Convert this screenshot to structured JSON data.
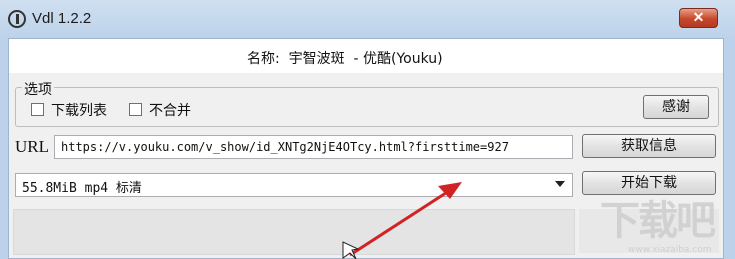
{
  "window": {
    "title": "Vdl 1.2.2",
    "close_label": "✕"
  },
  "info": {
    "name_text": "名称:  宇智波斑  - 优酷(Youku)"
  },
  "options": {
    "group_label": "选项",
    "download_list_label": "下载列表",
    "no_merge_label": "不合并",
    "thanks_label": "感谢"
  },
  "url": {
    "label": "URL",
    "value": "https://v.youku.com/v_show/id_XNTg2NjE4OTcy.html?firsttime=927",
    "fetch_label": "获取信息"
  },
  "format": {
    "selected": "55.8MiB mp4 标清",
    "download_label": "开始下载"
  },
  "watermark": {
    "text": "下载吧",
    "sub": "www.xiazaiba.com"
  },
  "colors": {
    "arrow": "#d02424",
    "close": "#c6472b",
    "titlebar": "#bcd2ea"
  }
}
